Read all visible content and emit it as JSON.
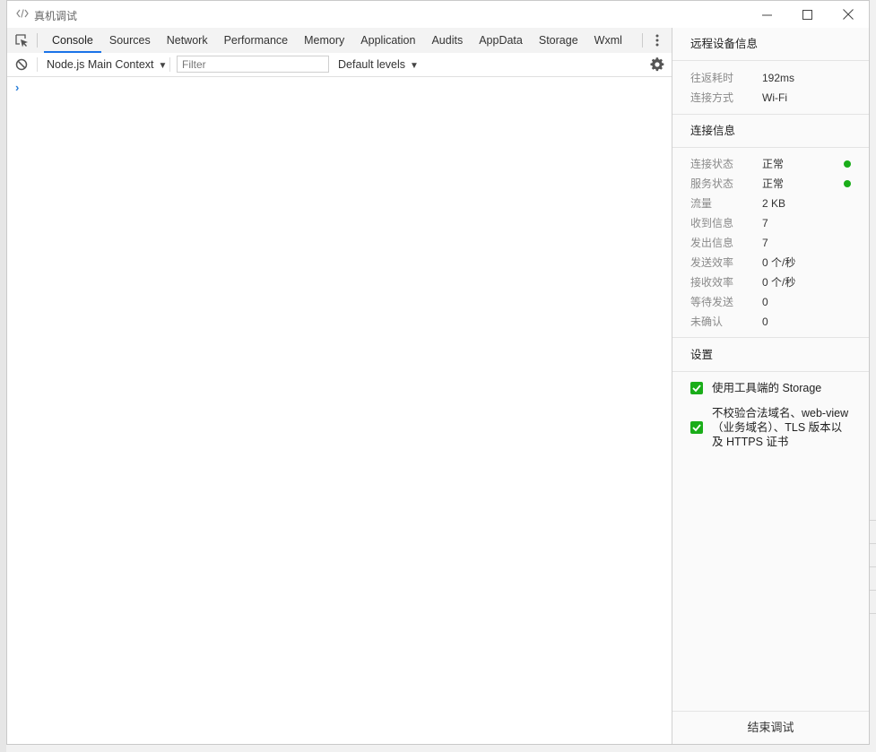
{
  "window": {
    "title": "真机调试"
  },
  "devtools": {
    "tabs": [
      {
        "label": "Console",
        "active": true
      },
      {
        "label": "Sources",
        "active": false
      },
      {
        "label": "Network",
        "active": false
      },
      {
        "label": "Performance",
        "active": false
      },
      {
        "label": "Memory",
        "active": false
      },
      {
        "label": "Application",
        "active": false
      },
      {
        "label": "Audits",
        "active": false
      },
      {
        "label": "AppData",
        "active": false
      },
      {
        "label": "Storage",
        "active": false
      },
      {
        "label": "Wxml",
        "active": false
      }
    ],
    "toolbar": {
      "context": "Node.js Main Context",
      "filter_placeholder": "Filter",
      "filter_value": "",
      "levels": "Default levels"
    },
    "prompt": "›"
  },
  "panel": {
    "remote_device": {
      "title": "远程设备信息",
      "rows": [
        {
          "key": "往返耗时",
          "value": "192ms"
        },
        {
          "key": "连接方式",
          "value": "Wi-Fi"
        }
      ]
    },
    "connection": {
      "title": "连接信息",
      "rows": [
        {
          "key": "连接状态",
          "value": "正常",
          "status": "ok"
        },
        {
          "key": "服务状态",
          "value": "正常",
          "status": "ok"
        },
        {
          "key": "流量",
          "value": "2 KB"
        },
        {
          "key": "收到信息",
          "value": "7"
        },
        {
          "key": "发出信息",
          "value": "7"
        },
        {
          "key": "发送效率",
          "value": "0 个/秒"
        },
        {
          "key": "接收效率",
          "value": "0 个/秒"
        },
        {
          "key": "等待发送",
          "value": "0"
        },
        {
          "key": "未确认",
          "value": "0"
        }
      ]
    },
    "settings": {
      "title": "设置",
      "options": [
        {
          "label": "使用工具端的 Storage",
          "checked": true
        },
        {
          "label": "不校验合法域名、web-view（业务域名）、TLS 版本以及 HTTPS 证书",
          "checked": true
        }
      ]
    },
    "end_button": "结束调试"
  },
  "colors": {
    "accent_green": "#1aad19",
    "tab_active_blue": "#1a73e8",
    "prompt_blue": "#2b7fd8"
  }
}
